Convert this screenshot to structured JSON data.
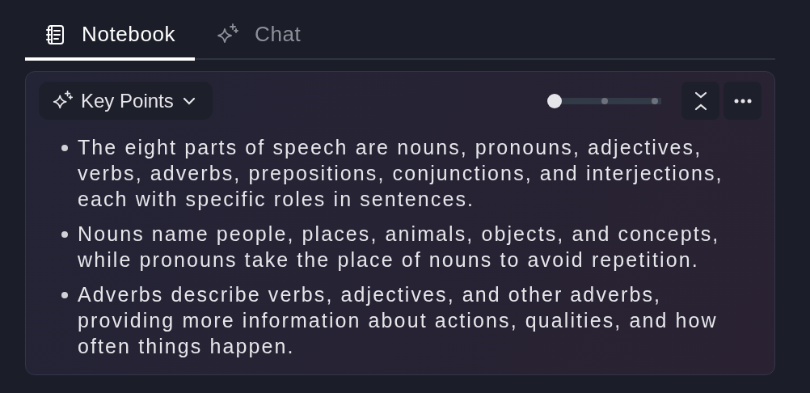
{
  "tabs": [
    {
      "label": "Notebook",
      "selected": true
    },
    {
      "label": "Chat",
      "selected": false
    }
  ],
  "panel": {
    "mode_button": {
      "label": "Key Points"
    },
    "detail_slider": {
      "level": 0
    },
    "points": [
      "The eight parts of speech are nouns, pronouns, adjectives, verbs, adverbs, prepositions, conjunctions, and interjections, each with specific roles in sentences.",
      "Nouns name people, places, animals, objects, and concepts, while pronouns take the place of nouns to avoid repetition.",
      "Adverbs describe verbs, adjectives, and other adverbs, providing more information about actions, qualities, and how often things happen."
    ]
  }
}
